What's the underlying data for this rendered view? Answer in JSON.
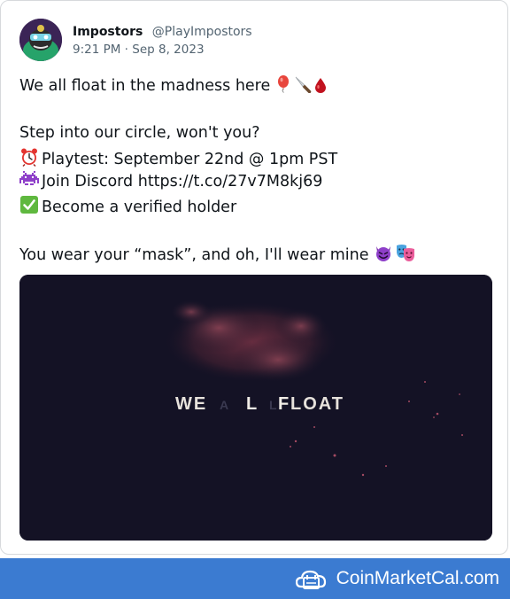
{
  "tweet": {
    "author_name": "Impostors",
    "author_handle": "@PlayImpostors",
    "timestamp": "9:21 PM · Sep 8, 2023",
    "lines": {
      "line1": "We all float in the madness here",
      "line2": "Step into our circle, won't you?",
      "line3": "Playtest: September 22nd @ 1pm PST",
      "line4": "Join Discord https://t.co/27v7M8kj69",
      "line5": "Become a verified holder",
      "line6": "You wear your “mask”, and oh, I'll wear mine"
    },
    "media": {
      "overlay_text_parts": [
        "WE",
        "A",
        "L",
        "L",
        "F",
        "LOAT"
      ]
    }
  },
  "footer": {
    "brand": "CoinMarketCal.com",
    "color": "#3b7bd1"
  },
  "icons": [
    "balloon-icon",
    "knife-icon",
    "blood-drop-icon",
    "alarm-clock-icon",
    "alien-monster-icon",
    "check-mark-icon",
    "devil-face-icon",
    "theater-masks-icon",
    "calendar-cloud-icon"
  ]
}
